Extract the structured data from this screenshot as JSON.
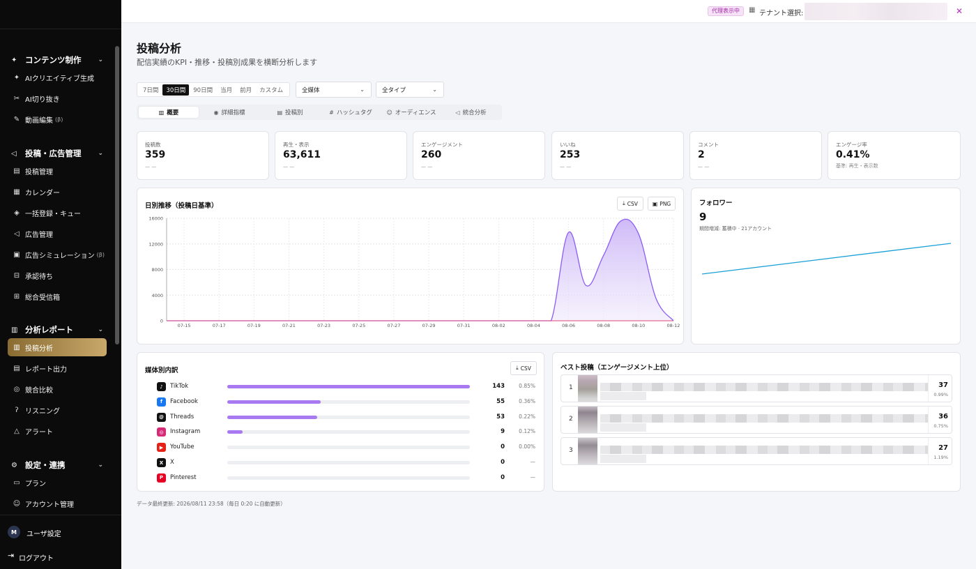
{
  "sidebar": {
    "sections": [
      {
        "label": "コンテンツ制作",
        "items": [
          {
            "label": "AIクリエイティブ生成",
            "beta": ""
          },
          {
            "label": "AI切り抜き",
            "beta": ""
          },
          {
            "label": "動画編集",
            "beta": "(β)"
          }
        ]
      },
      {
        "label": "投稿・広告管理",
        "items": [
          {
            "label": "投稿管理",
            "beta": ""
          },
          {
            "label": "カレンダー",
            "beta": ""
          },
          {
            "label": "一括登録・キュー",
            "beta": ""
          },
          {
            "label": "広告管理",
            "beta": ""
          },
          {
            "label": "広告シミュレーション",
            "beta": "(β)"
          },
          {
            "label": "承認待ち",
            "beta": ""
          },
          {
            "label": "総合受信箱",
            "beta": ""
          }
        ]
      },
      {
        "label": "分析レポート",
        "items": [
          {
            "label": "投稿分析",
            "beta": ""
          },
          {
            "label": "レポート出力",
            "beta": ""
          },
          {
            "label": "競合比較",
            "beta": ""
          },
          {
            "label": "リスニング",
            "beta": ""
          },
          {
            "label": "アラート",
            "beta": ""
          }
        ]
      },
      {
        "label": "設定・連携",
        "items": [
          {
            "label": "プラン",
            "beta": ""
          },
          {
            "label": "アカウント管理",
            "beta": ""
          }
        ]
      }
    ],
    "user": {
      "initial": "M",
      "label": "ユーザ設定"
    },
    "logout": "ログアウト"
  },
  "topbar": {
    "proxy_badge": "代理表示中",
    "tenant_label": "テナント選択:",
    "close": "✕"
  },
  "page": {
    "title": "投稿分析",
    "subtitle": "配信実績のKPI・推移・投稿別成果を横断分析します"
  },
  "filters": {
    "ranges": [
      "7日間",
      "30日間",
      "90日間",
      "当月",
      "前月",
      "カスタム"
    ],
    "active_range": "30日間",
    "media": "全媒体",
    "type": "全タイプ"
  },
  "tabs": [
    {
      "label": "概要",
      "icon": "bar-chart-icon",
      "glyph": "▥",
      "active": true
    },
    {
      "label": "詳細指標",
      "icon": "eye-icon",
      "glyph": "◉",
      "active": false
    },
    {
      "label": "投稿別",
      "icon": "file-icon",
      "glyph": "▤",
      "active": false
    },
    {
      "label": "ハッシュタグ",
      "icon": "hash-icon",
      "glyph": "#",
      "active": false
    },
    {
      "label": "オーディエンス",
      "icon": "users-icon",
      "glyph": "☺",
      "active": false
    },
    {
      "label": "統合分析",
      "icon": "megaphone-icon",
      "glyph": "◁",
      "active": false
    }
  ],
  "kpis": [
    {
      "label": "投稿数",
      "value": "359",
      "delta": "— —"
    },
    {
      "label": "再生・表示",
      "value": "63,611",
      "delta": "— —"
    },
    {
      "label": "エンゲージメント",
      "value": "260",
      "delta": "— —"
    },
    {
      "label": "いいね",
      "value": "253",
      "delta": "— —"
    },
    {
      "label": "コメント",
      "value": "2",
      "delta": "— —"
    },
    {
      "label": "エンゲージ率",
      "value": "0.41%",
      "delta": "基準: 再生・表示数"
    }
  ],
  "daily_card": {
    "title": "日別推移（投稿日基準）",
    "csv": "CSV",
    "png": "PNG"
  },
  "follower_card": {
    "title": "フォロワー",
    "value": "9",
    "note": "期間増減: 蓄積中 · 21アカウント"
  },
  "media_card": {
    "title": "媒体別内訳",
    "csv": "CSV",
    "rows": [
      {
        "name": "TikTok",
        "icon": "tiktok-icon",
        "glyph": "♪",
        "color": "#111111",
        "count": "143",
        "rate": "0.85%",
        "share": 1.0
      },
      {
        "name": "Facebook",
        "icon": "facebook-icon",
        "glyph": "f",
        "color": "#1877f2",
        "count": "55",
        "rate": "0.36%",
        "share": 0.385
      },
      {
        "name": "Threads",
        "icon": "threads-icon",
        "glyph": "@",
        "color": "#111111",
        "count": "53",
        "rate": "0.22%",
        "share": 0.371
      },
      {
        "name": "Instagram",
        "icon": "instagram-icon",
        "glyph": "◎",
        "color": "#d62976",
        "count": "9",
        "rate": "0.12%",
        "share": 0.063
      },
      {
        "name": "YouTube",
        "icon": "youtube-icon",
        "glyph": "▶",
        "color": "#e62117",
        "count": "0",
        "rate": "0.00%",
        "share": 0
      },
      {
        "name": "X",
        "icon": "x-icon",
        "glyph": "X",
        "color": "#111111",
        "count": "0",
        "rate": "—",
        "share": 0
      },
      {
        "name": "Pinterest",
        "icon": "pinterest-icon",
        "glyph": "P",
        "color": "#e60023",
        "count": "0",
        "rate": "—",
        "share": 0
      }
    ]
  },
  "best_card": {
    "title": "ベスト投稿（エンゲージメント上位）",
    "rows": [
      {
        "rank": "1",
        "value": "37",
        "rate": "0.99%"
      },
      {
        "rank": "2",
        "value": "36",
        "rate": "0.75%"
      },
      {
        "rank": "3",
        "value": "27",
        "rate": "1.19%"
      }
    ]
  },
  "footnote": "データ最終更新: 2026/08/11 23:58（毎日 0:20 に自動更新）",
  "colors": {
    "accent": "#a879f0",
    "area_line": "#8b5cf6",
    "follower_line": "#1a9fd6",
    "active_nav": "#b8944e"
  },
  "chart_data": [
    {
      "type": "area",
      "title": "日別推移（投稿日基準）",
      "x_tick_labels": [
        "07-15",
        "07-17",
        "07-19",
        "07-21",
        "07-23",
        "07-25",
        "07-27",
        "07-29",
        "07-31",
        "08-02",
        "08-04",
        "08-06",
        "08-08",
        "08-10",
        "08-12"
      ],
      "x": [
        "07-14",
        "07-15",
        "07-16",
        "07-17",
        "07-18",
        "07-19",
        "07-20",
        "07-21",
        "07-22",
        "07-23",
        "07-24",
        "07-25",
        "07-26",
        "07-27",
        "07-28",
        "07-29",
        "07-30",
        "07-31",
        "08-01",
        "08-02",
        "08-03",
        "08-04",
        "08-05",
        "08-06",
        "08-07",
        "08-08",
        "08-09",
        "08-10",
        "08-11",
        "08-12"
      ],
      "ylim": [
        0,
        16000
      ],
      "y_ticks": [
        0,
        4000,
        8000,
        12000,
        16000
      ],
      "grid": true,
      "series": [
        {
          "values": [
            0,
            0,
            0,
            0,
            0,
            0,
            0,
            0,
            0,
            0,
            0,
            0,
            0,
            0,
            0,
            0,
            0,
            0,
            0,
            0,
            0,
            0,
            0,
            13800,
            5500,
            10200,
            15600,
            13600,
            3500,
            0
          ]
        },
        {
          "values": [
            0,
            0,
            0,
            0,
            0,
            0,
            0,
            0,
            0,
            0,
            0,
            0,
            0,
            0,
            0,
            0,
            0,
            0,
            0,
            0,
            0,
            0,
            0,
            0,
            0,
            0,
            0,
            0,
            0,
            0
          ]
        }
      ]
    },
    {
      "type": "line",
      "title": "フォロワー",
      "series": [
        {
          "values": [
            0,
            1
          ]
        }
      ]
    }
  ]
}
